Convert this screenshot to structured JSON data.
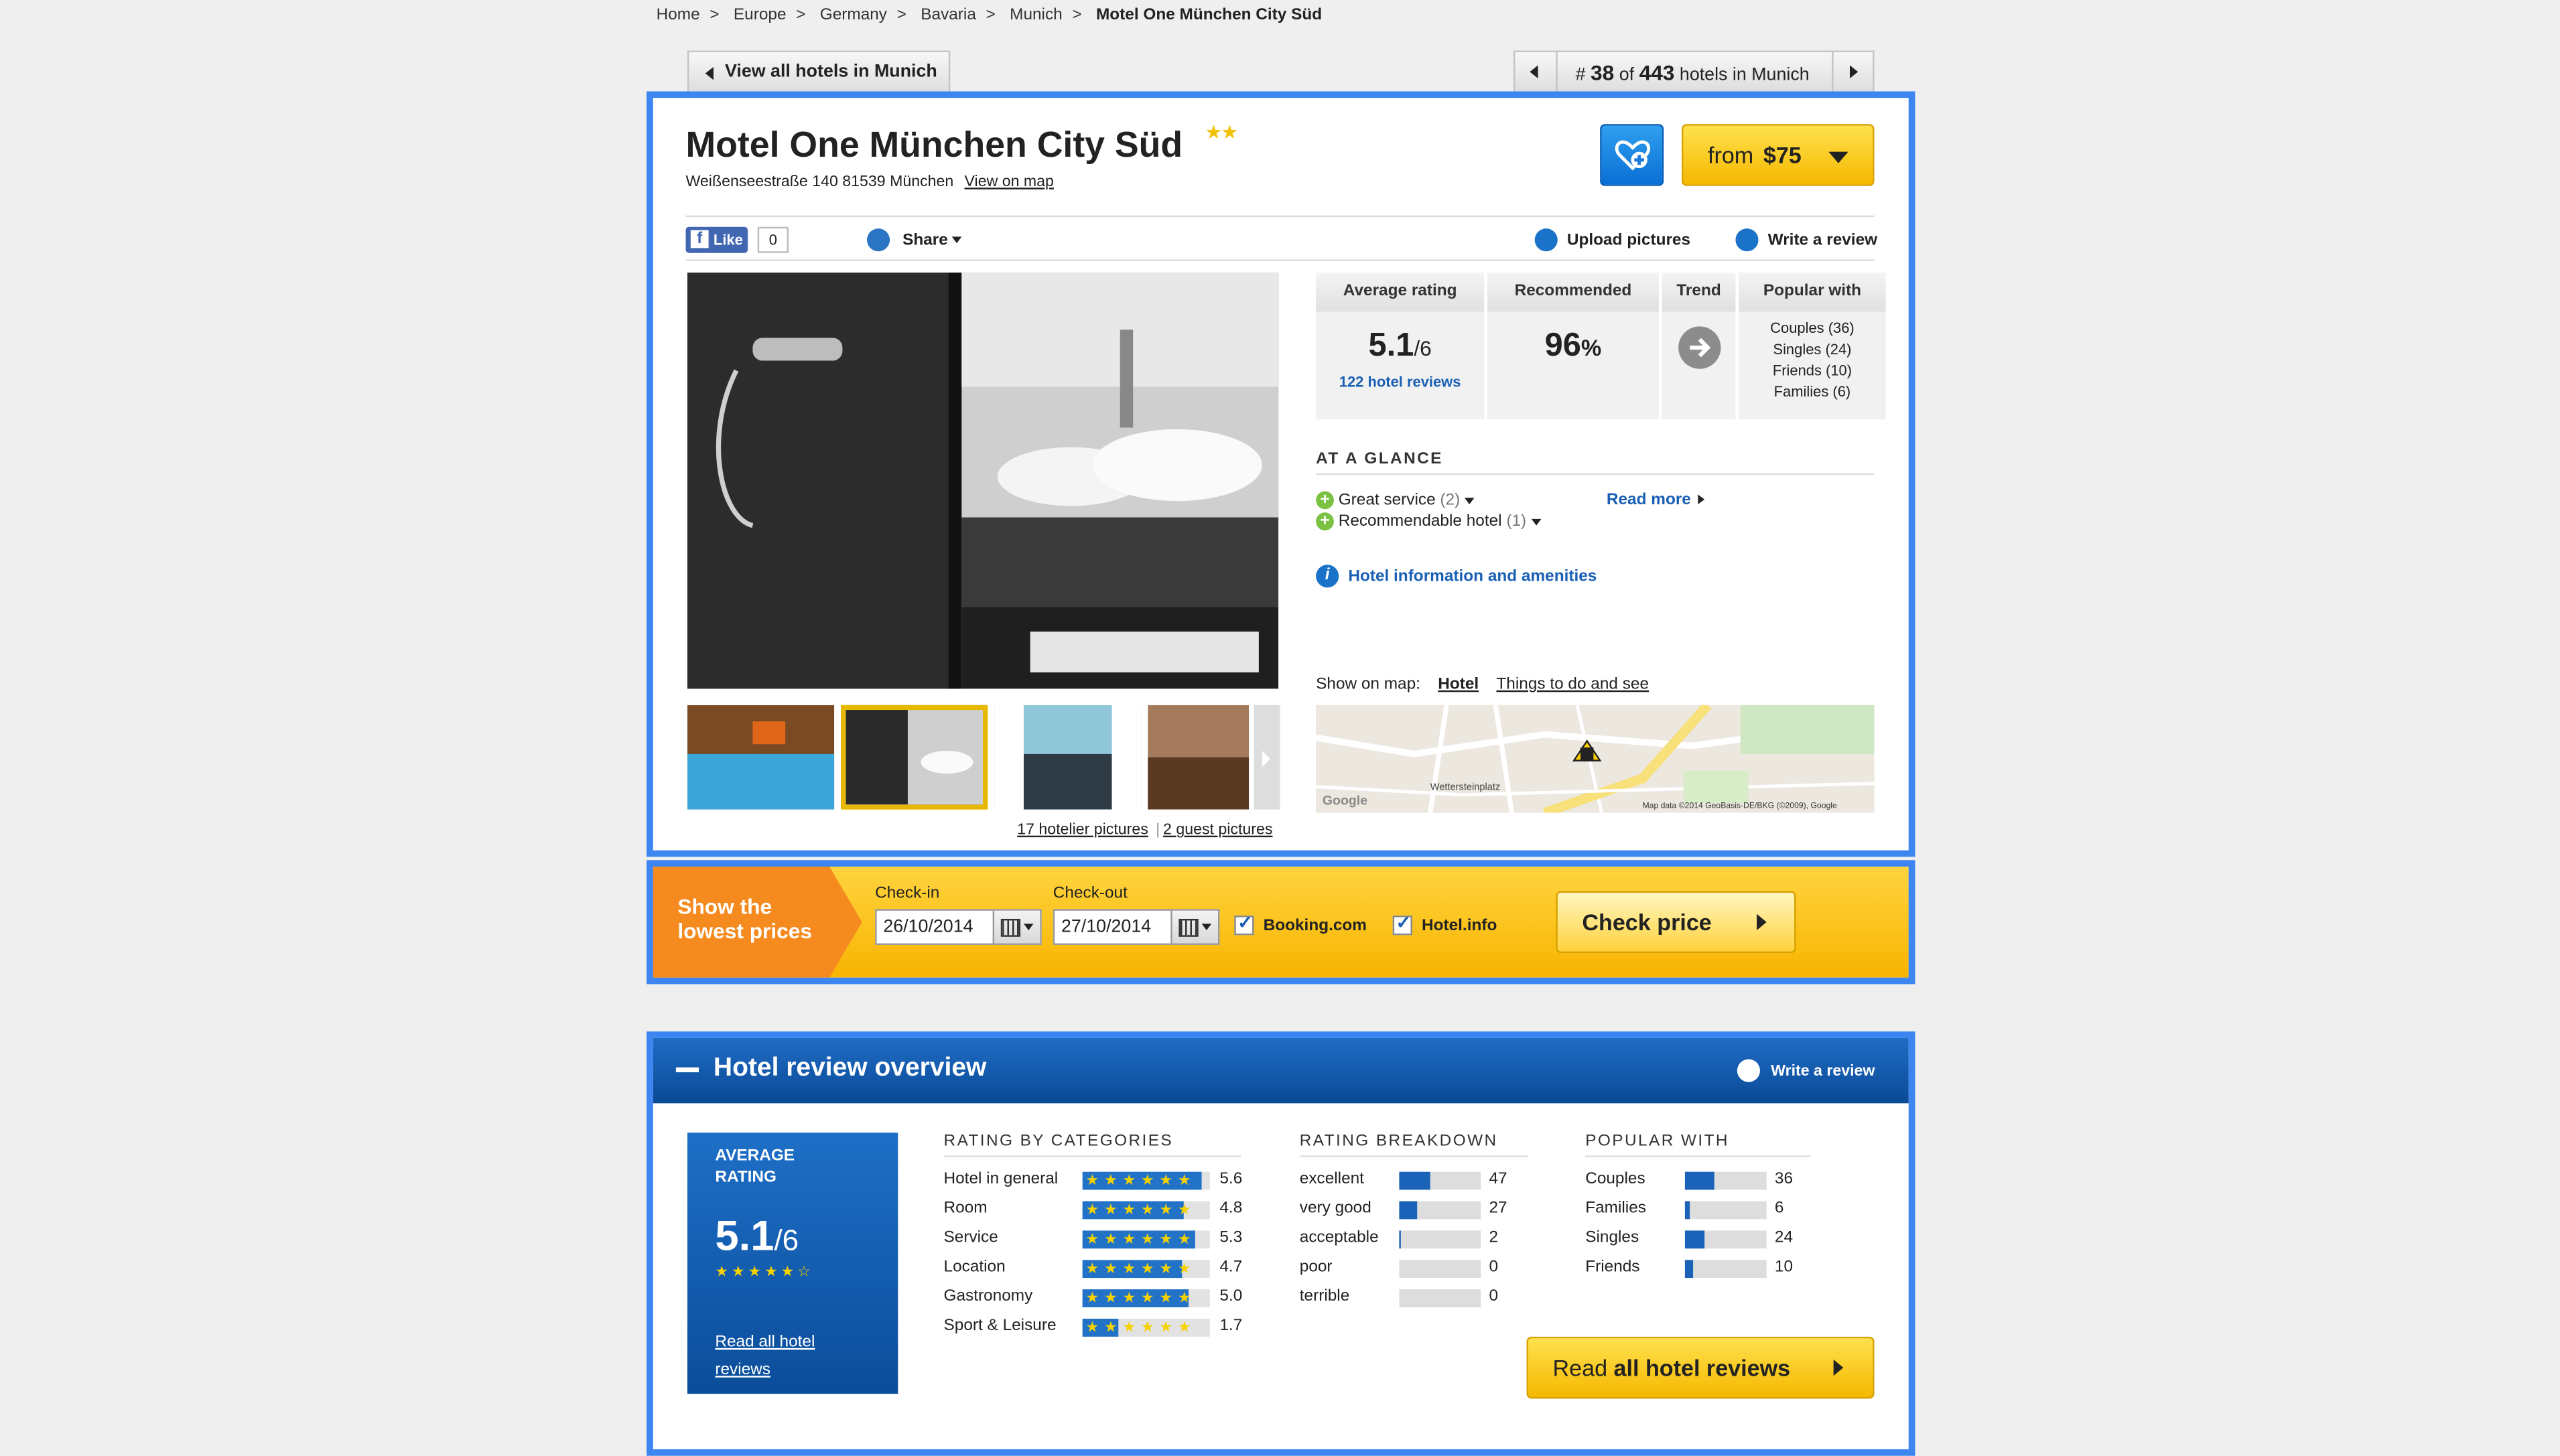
{
  "breadcrumb": [
    "Home",
    "Europe",
    "Germany",
    "Bavaria",
    "Munich"
  ],
  "breadcrumb_current": "Motel One München City Süd",
  "nav": {
    "view_all": "View all hotels in Munich",
    "rank_prefix": "#",
    "rank": "38",
    "of": "of",
    "total": "443",
    "suffix": "hotels in Munich"
  },
  "hotel": {
    "name": "Motel One München City Süd",
    "stars": "★★",
    "address": "Weißenseestraße 140 81539 München",
    "view_map": "View on map",
    "price_from": "from",
    "price": "$75"
  },
  "toolbar": {
    "like": "Like",
    "like_count": "0",
    "share": "Share",
    "upload": "Upload pictures",
    "write_review": "Write a review"
  },
  "photos": {
    "hotelier": "17 hotelier pictures",
    "guest": "2 guest pictures"
  },
  "ratings": {
    "avg_label": "Average rating",
    "avg_value": "5.1",
    "avg_scale": "/6",
    "reviews_link": "122 hotel reviews",
    "rec_label": "Recommended",
    "rec_value": "96",
    "rec_unit": "%",
    "trend_label": "Trend",
    "popular_label": "Popular with",
    "popular": [
      "Couples (36)",
      "Singles (24)",
      "Friends (10)",
      "Families (6)"
    ]
  },
  "glance": {
    "title": "AT A GLANCE",
    "items": [
      {
        "label": "Great service",
        "count": "(2)"
      },
      {
        "label": "Recommendable hotel",
        "count": "(1)"
      }
    ],
    "read_more": "Read more",
    "info": "Hotel information and amenities"
  },
  "map": {
    "show_label": "Show on map:",
    "hotel": "Hotel",
    "things": "Things to do and see",
    "place": "Wettersteinplatz",
    "credit": "Map data ©2014 GeoBasis-DE/BKG (©2009), Google",
    "google": "Google"
  },
  "pricebar": {
    "headline1": "Show the",
    "headline2": "lowest prices",
    "checkin_label": "Check-in",
    "checkin": "26/10/2014",
    "checkout_label": "Check-out",
    "checkout": "27/10/2014",
    "site1": "Booking.com",
    "site2": "Hotel.info",
    "button": "Check price"
  },
  "overview": {
    "title": "Hotel review overview",
    "write_review": "Write a review",
    "avg_title1": "AVERAGE",
    "avg_title2": "RATING",
    "avg_value": "5.1",
    "avg_scale": "/6",
    "read_all1": "Read all hotel",
    "read_all2": "reviews",
    "categories_title": "RATING BY CATEGORIES",
    "categories": [
      {
        "name": "Hotel in general",
        "score": "5.6",
        "value": 5.6
      },
      {
        "name": "Room",
        "score": "4.8",
        "value": 4.8
      },
      {
        "name": "Service",
        "score": "5.3",
        "value": 5.3
      },
      {
        "name": "Location",
        "score": "4.7",
        "value": 4.7
      },
      {
        "name": "Gastronomy",
        "score": "5.0",
        "value": 5.0
      },
      {
        "name": "Sport & Leisure",
        "score": "1.7",
        "value": 1.7
      }
    ],
    "breakdown_title": "RATING BREAKDOWN",
    "breakdown": [
      {
        "name": "excellent",
        "count": "47",
        "value": 47
      },
      {
        "name": "very good",
        "count": "27",
        "value": 27
      },
      {
        "name": "acceptable",
        "count": "2",
        "value": 2
      },
      {
        "name": "poor",
        "count": "0",
        "value": 0
      },
      {
        "name": "terrible",
        "count": "0",
        "value": 0
      }
    ],
    "popular_title": "POPULAR WITH",
    "popular": [
      {
        "name": "Couples",
        "count": "36",
        "value": 36
      },
      {
        "name": "Families",
        "count": "6",
        "value": 6
      },
      {
        "name": "Singles",
        "count": "24",
        "value": 24
      },
      {
        "name": "Friends",
        "count": "10",
        "value": 10
      }
    ],
    "read_all_button1": "Read",
    "read_all_button2": "all hotel reviews"
  },
  "colors": {
    "frame_blue": "#3d86f2",
    "header_blue": "#0a4a96",
    "price_yellow": "#f5b800",
    "link_blue": "#1a5fb4",
    "plus_green": "#7cc242"
  }
}
